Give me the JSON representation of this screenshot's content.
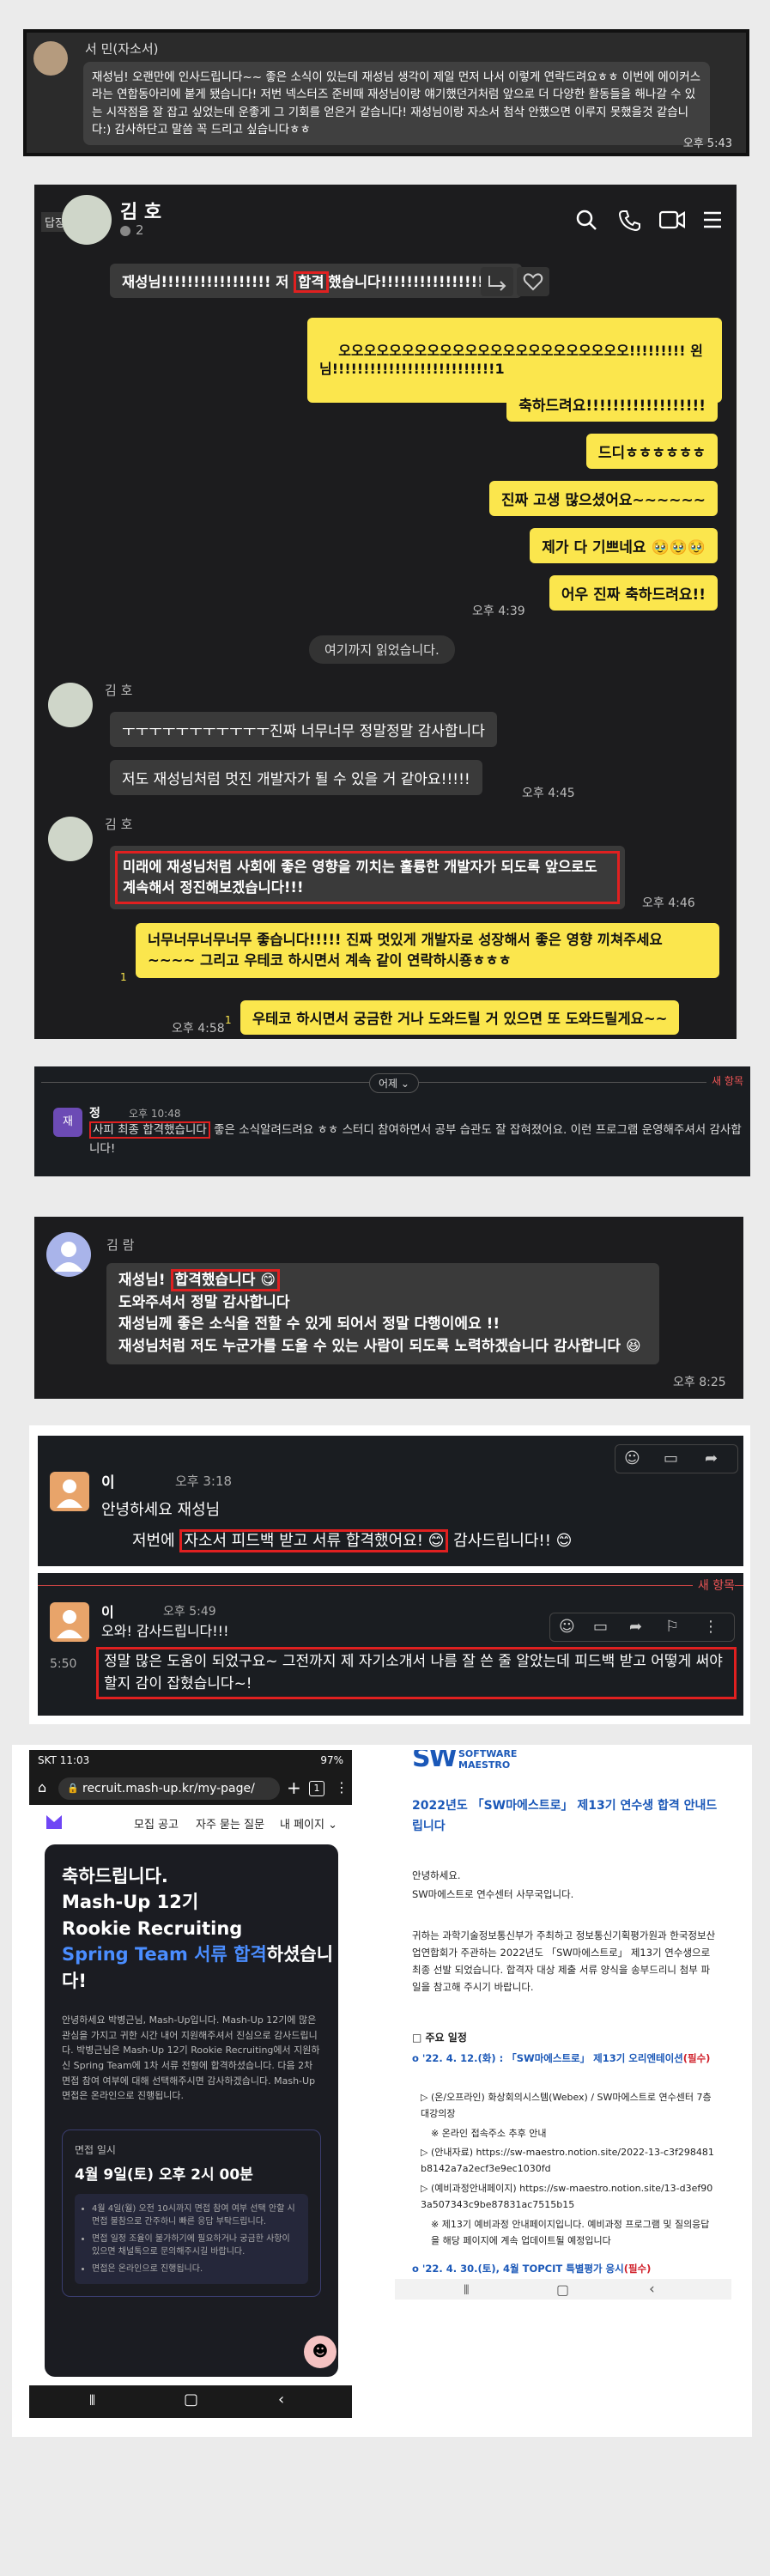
{
  "panel1": {
    "sender": "서   민(자소서)",
    "message": "재성님! 오랜만에 인사드립니다~~ 좋은 소식이 있는데 재성님 생각이 제일 먼저 나서 이렇게 연락드려요ㅎㅎ 이번에 에이커스라는 연합동아리에 붙게 됐습니다! 저번 넥스터즈 준비때 재성님이랑 얘기했던거처럼 앞으로 더 다양한 활동들을 해나갈 수 있는 시작점을 잘 잡고 싶었는데 운좋게 그 기회를 얻은거 같습니다! 재성님이랑 자소서 첨삭 안했으면 이루지 못했을것 같습니다:) 감사하단고 말씀 꼭 드리고 싶습니다ㅎㅎ",
    "time": "오후 5:43"
  },
  "panel2": {
    "reply_label": "답장",
    "contact_name": "김   호",
    "member_count": "2",
    "msg_gray_top_pre": "재성님!!!!!!!!!!!!!!!!! 저 ",
    "msg_gray_top_hl": "합격",
    "msg_gray_top_post": "했습니다!!!!!!!!!!!!!!!!!!!!",
    "yellow_msgs": [
      "오오오오오오오오오오오오오오오오오오오오오오오!!!!!!!!! 왼\n님!!!!!!!!!!!!!!!!!!!!!!!!!!1",
      "축하드려요!!!!!!!!!!!!!!!!!!",
      "드디ㅎㅎㅎㅎㅎㅎ",
      "진짜 고생 많으셨어요~~~~~~",
      "제가 다 기쁘네요 🥹🥹🥹",
      "어우 진짜 축하드려요!!"
    ],
    "time_1": "오후 4:39",
    "read_divider": "여기까지 읽었습니다.",
    "sender_name_1": "김   호",
    "gray_msgs": [
      "ㅜㅜㅜㅜㅜㅜㅜㅜㅜㅜㅜ진짜 너무너무 정말정말 감사합니다",
      "저도 재성님처럼 멋진 개발자가 될 수 있을 거 같아요!!!!!"
    ],
    "time_2": "오후 4:45",
    "sender_name_2": "김   호",
    "gray_hl_msg": "미래에 재성님처럼 사회에 좋은 영향을 끼치는 훌륭한 개발자가 되도록 앞으로도 계속해서 정진해보겠습니다!!!",
    "time_3": "오후 4:46",
    "yellow_msg_long": "너무너무너무너무 좋습니다!!!!! 진짜 멋있게 개발자로 성장해서 좋은 영향 끼쳐주세요~~~~ 그리고 우테코 하시면서 계속 같이 연락하시죵ㅎㅎㅎ",
    "unread_1": "1",
    "yellow_msg_last": "우테코 하시면서 궁금한 거나 도와드릴 거 있으면 또 도와드릴게요~~",
    "unread_2": "1",
    "time_4": "오후 4:58"
  },
  "panel3": {
    "date_label": "어제",
    "new_label": "새 항목",
    "avatar_text": "재",
    "sender": "정   ",
    "time": "오후 10:48",
    "hl_text": "사피 최종 합격했습니다",
    "rest_text": " 좋은 소식알려드려요 ㅎㅎ 스터디 참여하면서 공부 습관도 잘 잡혀졌어요. 이런 프로그램 운영해주셔서 감사합니다!"
  },
  "panel4": {
    "sender": "김   람",
    "line1_pre": "재성님! ",
    "line1_hl": "합격했습니다 😋",
    "line2": "도와주셔서 정말 감사합니다",
    "line3": "재성님께 좋은 소식을 전할 수 있게 되어서 정말 다행이에요 !!",
    "line4": "재성님처럼 저도 누군가를 도울 수 있는 사람이 되도록 노력하겠습니다 감사합니다 😆",
    "time": "오후 8:25"
  },
  "panel5": {
    "sender_1": "이   ",
    "time_1": "오후 3:18",
    "greet": "안녕하세요 재성님",
    "msg_pre": "저번에 ",
    "msg_hl": "자소서 피드백 받고 서류 합격했어요! 😊",
    "msg_post": " 감사드립니다!! 😊",
    "new_label": "새 항목",
    "sender_2": "이   ",
    "time_2": "오후 5:49",
    "msg2": "오와! 감사드립니다!!!",
    "side_time": "5:50",
    "msg3": "정말 많은 도움이 되었구요~ 그전까지 제 자기소개서 나름 잘 쓴 줄 알았는데 피드백 받고 어떻게 써야 할지 감이 잡혔습니다~!"
  },
  "panel6": {
    "status_time": "SKT 11:03",
    "battery": "97%",
    "url": "recruit.mash-up.kr/my-page/",
    "tab_count": "1",
    "nav_items": [
      "모집 공고",
      "자주 묻는 질문",
      "내 페이지"
    ],
    "title1": "축하드립니다.",
    "title2": "Mash-Up 12기",
    "title3": "Rookie Recruiting",
    "title4_blue": "Spring Team 서류 합격",
    "title4_rest": "하셨습니",
    "title5": "다!",
    "desc": "안녕하세요 박병근님, Mash-Up입니다. Mash-Up 12기에 많은 관심을 가지고 귀한 시간 내어 지원해주셔서 진심으로 감사드립니다. 박병근님은 Mash-Up 12기 Rookie Recruiting에서 지원하신 Spring Team에 1차 서류 전형에 합격하셨습니다. 다음 2차 면접 참여 여부에 대해 선택해주시면 감사하겠습니다. Mash-Up 면접은 온라인으로 진행됩니다.",
    "interview_label": "면접 일시",
    "interview_date": "4월 9일(토) 오후 2시 00분",
    "bullets": [
      "4월 4일(월) 오전 10시까지 면접 참여 여부 선택 안할 시 면접 불참으로 간주하니 빠른 응답 부탁드립니다.",
      "면접 일정 조율이 불가하기에 필요하거나 궁금한 사항이 있으면 채널톡으로 문의해주시길 바랍니다.",
      "면접은 온라인으로 진행됩니다."
    ]
  },
  "panel7": {
    "logo_text": "SOFTWARE MAESTRO",
    "logo_big": "SW",
    "title": "2022년도 「SW마에스트로」 제13기 연수생 합격 안내드립니다",
    "greet1": "안녕하세요.",
    "greet2": "SW마에스트로 연수센터 사무국입니다.",
    "body": "귀하는 과학기술정보통신부가 주최하고 정보통신기획평가원과 한국정보산업연합회가 주관하는 2022년도 「SW마에스트로」 제13기 연수생으로 최종 선발 되었습니다. 합격자 대상 제출 서류 양식을 송부드리니 첨부 파일을 참고해 주시기 바랍니다.",
    "section": "□ 주요 일정",
    "item1_date": "o '22. 4. 12.(화) : 「SW마에스트로」 제13기 오리엔테이션",
    "item1_req": "(필수)",
    "item1_sub1": "▷ (온/오프라인) 화상회의시스템(Webex) / SW마에스트로 연수센터 7층 대강의장",
    "item1_sub2": "※ 온라인 접속주소 추후 안내",
    "item1_sub3": "▷ (안내자료) https://sw-maestro.notion.site/2022-13-c3f298481b8142a7a2ecf3e9ec1030fd",
    "item1_sub4": "▷ (예비과정안내페이지) https://sw-maestro.notion.site/13-d3ef903a507343c9be87831ac7515b15",
    "item1_sub5": "※ 제13기 예비과정 안내페이지입니다. 예비과정 프로그램 및 질의응답을 해당 페이지에 계속 업데이트될 예정입니다",
    "item2": "o '22. 4. 30.(토), 4월 TOPCIT 특별평가 응시",
    "item2_req": "(필수)"
  },
  "colors": {
    "kakao_yellow": "#fbe64d",
    "highlight_red": "#e02020",
    "chat_dark": "#1c1c1e",
    "spring_blue": "#4a8dff",
    "sw_blue": "#1b58b8"
  }
}
